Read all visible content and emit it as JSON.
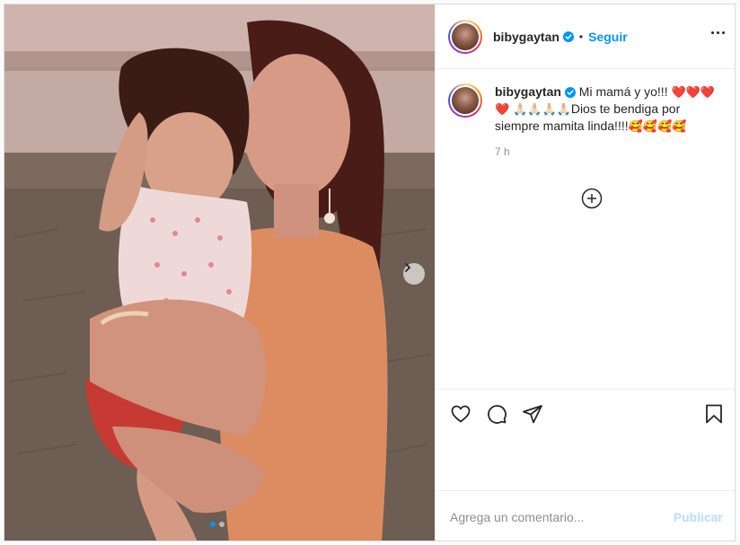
{
  "post": {
    "username": "bibygaytan",
    "verified": true,
    "follow_label": "Seguir",
    "bullet": "•",
    "caption": {
      "text": "Mi mamá y yo!!! ",
      "hearts": "❤️❤️❤️❤️",
      "hands": "🙏🏻🙏🏻🙏🏻🙏🏻",
      "text2": "Dios te bendiga por siempre mamita linda!!!!",
      "faces": "🥰🥰🥰🥰"
    },
    "timestamp": "7 h",
    "carousel": {
      "current": 1,
      "total": 2
    }
  },
  "comment_box": {
    "placeholder": "Agrega un comentario...",
    "publish_label": "Publicar"
  },
  "colors": {
    "accent": "#0095f6",
    "publish_disabled": "#b2dffc"
  },
  "icons": {
    "verified": "verified-badge-icon",
    "more": "more-options-icon",
    "next": "chevron-right-icon",
    "load_more": "plus-circle-icon",
    "like": "heart-icon",
    "comment": "comment-bubble-icon",
    "share": "paper-plane-icon",
    "save": "bookmark-icon"
  }
}
